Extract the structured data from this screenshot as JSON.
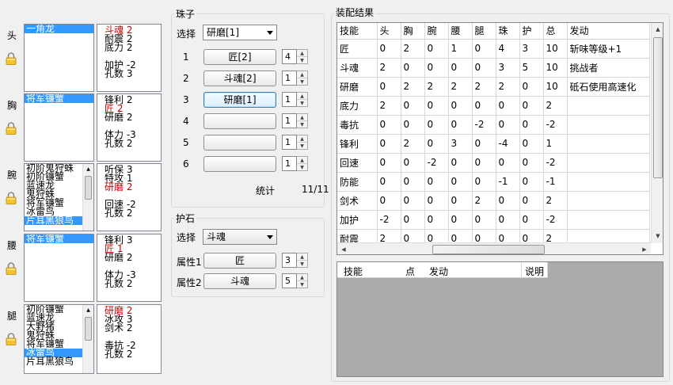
{
  "slots": [
    {
      "label": "头",
      "items": [
        {
          "t": "一角龙",
          "sel": true
        }
      ],
      "stats": [
        {
          "t": "斗魂 2",
          "red": true
        },
        {
          "t": "耐震 2"
        },
        {
          "t": "底力 2"
        },
        {
          "gap": true
        },
        {
          "t": "加护 -2"
        },
        {
          "t": "孔数 3"
        }
      ]
    },
    {
      "label": "胸",
      "items": [
        {
          "t": "将军镰蟹",
          "sel": true
        }
      ],
      "stats": [
        {
          "t": "锋利 2"
        },
        {
          "t": "匠 2",
          "red": true
        },
        {
          "t": "研磨 2"
        },
        {
          "gap": true
        },
        {
          "t": "体力 -3"
        },
        {
          "t": "孔数 2"
        }
      ]
    },
    {
      "label": "腕",
      "items": [
        {
          "t": "初阶鬼狩蛛"
        },
        {
          "t": "初阶镰蟹"
        },
        {
          "t": "蓝速龙"
        },
        {
          "t": "鬼狩蛛"
        },
        {
          "t": "将军镰蟹"
        },
        {
          "t": "冰雷鸟"
        },
        {
          "t": "片耳黑狼鸟",
          "sel": true
        }
      ],
      "stats": [
        {
          "t": "听保 3"
        },
        {
          "t": "特攻 1"
        },
        {
          "t": "研磨 2",
          "red": true
        },
        {
          "gap": true
        },
        {
          "t": "回速 -2"
        },
        {
          "t": "孔数 2"
        }
      ]
    },
    {
      "label": "腰",
      "items": [
        {
          "t": "将军镰蟹",
          "sel": true
        }
      ],
      "stats": [
        {
          "t": "锋利 3"
        },
        {
          "t": "匠 1",
          "red": true
        },
        {
          "t": "研磨 2"
        },
        {
          "gap": true
        },
        {
          "t": "体力 -3"
        },
        {
          "t": "孔数 2"
        }
      ]
    },
    {
      "label": "腿",
      "items": [
        {
          "t": "初阶镰蟹"
        },
        {
          "t": "蓝速龙"
        },
        {
          "t": "大野猪"
        },
        {
          "t": "鬼狩蛛"
        },
        {
          "t": "将军镰蟹"
        },
        {
          "t": "冰雷鸟",
          "sel": true
        },
        {
          "t": "片耳黑狼鸟"
        }
      ],
      "stats": [
        {
          "t": "研磨 2",
          "red": true
        },
        {
          "t": "冰攻 3"
        },
        {
          "t": "剑术 2"
        },
        {
          "gap": true
        },
        {
          "t": "毒抗 -2"
        },
        {
          "t": "孔数 2"
        }
      ]
    }
  ],
  "beads": {
    "title": "珠子",
    "select_label": "选择",
    "select_value": "研磨[1]",
    "rows": [
      {
        "n": "1",
        "btn": "匠[2]",
        "count": "4"
      },
      {
        "n": "2",
        "btn": "斗魂[2]",
        "count": "1"
      },
      {
        "n": "3",
        "btn": "研磨[1]",
        "count": "1",
        "focus": true
      },
      {
        "n": "4",
        "btn": "",
        "count": "1"
      },
      {
        "n": "5",
        "btn": "",
        "count": "1"
      },
      {
        "n": "6",
        "btn": "",
        "count": "1"
      }
    ],
    "stat_label": "统计",
    "stat_value": "11/11"
  },
  "amulet": {
    "title": "护石",
    "select_label": "选择",
    "select_value": "斗魂",
    "attr1_label": "属性1",
    "attr1_value": "匠",
    "attr1_count": "3",
    "attr2_label": "属性2",
    "attr2_value": "斗魂",
    "attr2_count": "5"
  },
  "result": {
    "title": "装配结果",
    "headers": [
      "技能",
      "头",
      "胸",
      "腕",
      "腰",
      "腿",
      "珠",
      "护",
      "总",
      "发动"
    ],
    "rows": [
      [
        "匠",
        "0",
        "2",
        "0",
        "1",
        "0",
        "4",
        "3",
        "10",
        "斩味等级+1"
      ],
      [
        "斗魂",
        "2",
        "0",
        "0",
        "0",
        "0",
        "3",
        "5",
        "10",
        "挑战者"
      ],
      [
        "研磨",
        "0",
        "2",
        "2",
        "2",
        "2",
        "2",
        "0",
        "10",
        "砥石使用高速化"
      ],
      [
        "底力",
        "2",
        "0",
        "0",
        "0",
        "0",
        "0",
        "0",
        "2",
        ""
      ],
      [
        "毒抗",
        "0",
        "0",
        "0",
        "0",
        "-2",
        "0",
        "0",
        "-2",
        ""
      ],
      [
        "锋利",
        "0",
        "2",
        "0",
        "3",
        "0",
        "-4",
        "0",
        "1",
        ""
      ],
      [
        "回速",
        "0",
        "0",
        "-2",
        "0",
        "0",
        "0",
        "0",
        "-2",
        ""
      ],
      [
        "防能",
        "0",
        "0",
        "0",
        "0",
        "0",
        "-1",
        "0",
        "-1",
        ""
      ],
      [
        "剑术",
        "0",
        "0",
        "0",
        "0",
        "2",
        "0",
        "0",
        "2",
        ""
      ],
      [
        "加护",
        "-2",
        "0",
        "0",
        "0",
        "0",
        "0",
        "0",
        "-2",
        ""
      ],
      [
        "耐震",
        "2",
        "0",
        "0",
        "0",
        "0",
        "0",
        "0",
        "2",
        ""
      ]
    ]
  },
  "detail": {
    "headers": [
      "技能",
      "点",
      "发动",
      "说明"
    ]
  }
}
